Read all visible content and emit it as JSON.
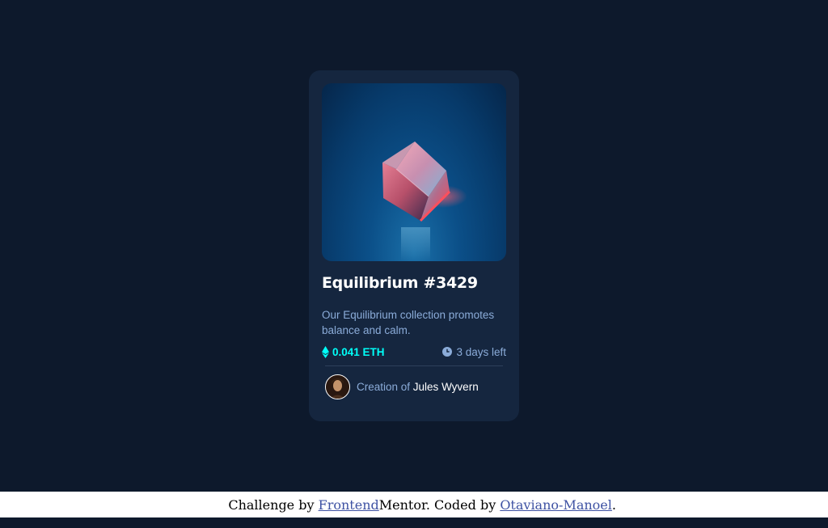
{
  "card": {
    "image_alt": "equilibrium-cube",
    "title": "Equilibrium #3429",
    "description": "Our Equilibrium collection promotes balance and calm.",
    "price": "0.041 ETH",
    "price_icon": "ethereum-icon",
    "time_left": "3 days left",
    "time_icon": "clock-icon",
    "creator_prefix": "Creation of ",
    "creator_name": "Jules Wyvern"
  },
  "footer": {
    "prefix": "Challenge by ",
    "link1": "Frontend",
    "middle": "Mentor. Coded by ",
    "link2": "Otaviano-Manoel",
    "suffix": "."
  },
  "colors": {
    "page_bg": "#0d192c",
    "card_bg": "#15263f",
    "accent": "#00fff8",
    "muted": "#8bacd9",
    "link": "#3e52a3"
  }
}
